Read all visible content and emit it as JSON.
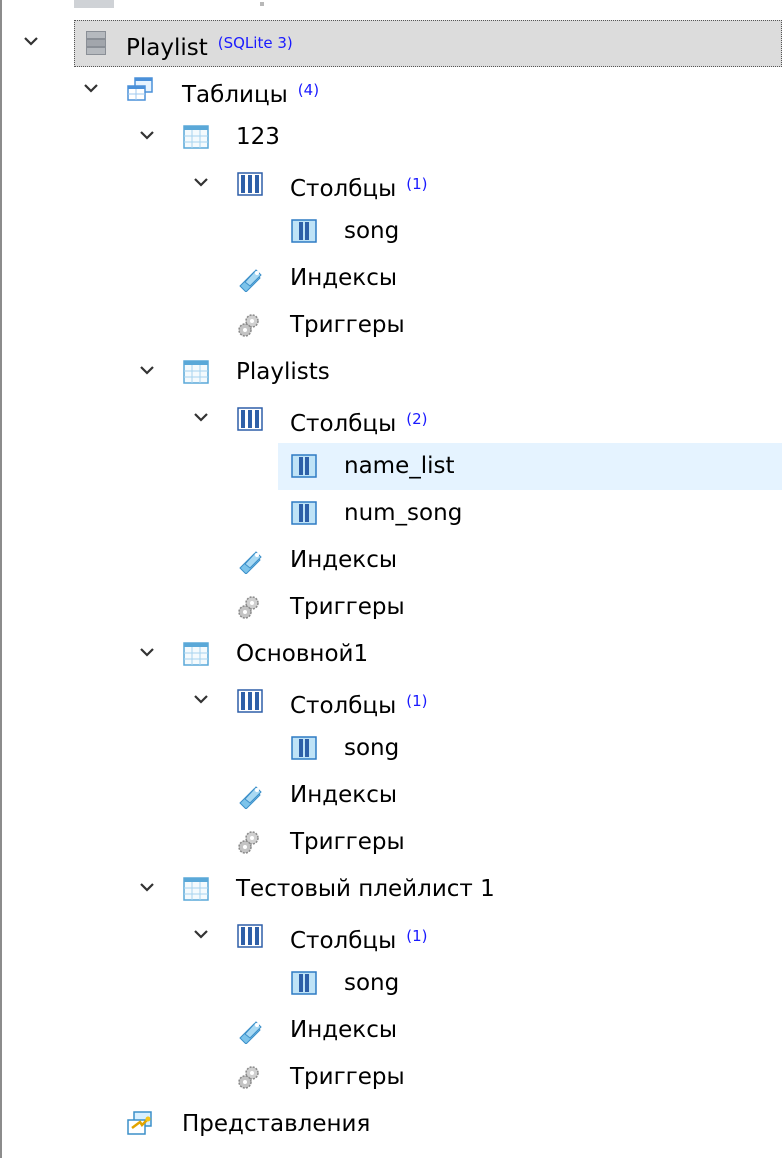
{
  "tree": {
    "root": {
      "label": "Playlist",
      "meta": "(SQLite 3)"
    },
    "tables_group": {
      "label": "Таблицы",
      "count": "(4)"
    },
    "tables": [
      {
        "name": "123",
        "columns_label": "Столбцы",
        "columns_count": "(1)",
        "columns": [
          "song"
        ],
        "indexes_label": "Индексы",
        "triggers_label": "Триггеры"
      },
      {
        "name": "Playlists",
        "columns_label": "Столбцы",
        "columns_count": "(2)",
        "columns": [
          "name_list",
          "num_song"
        ],
        "indexes_label": "Индексы",
        "triggers_label": "Триггеры"
      },
      {
        "name": "Основной1",
        "columns_label": "Столбцы",
        "columns_count": "(1)",
        "columns": [
          "song"
        ],
        "indexes_label": "Индексы",
        "triggers_label": "Триггеры"
      },
      {
        "name": "Тестовый плейлист 1",
        "columns_label": "Столбцы",
        "columns_count": "(1)",
        "columns": [
          "song"
        ],
        "indexes_label": "Индексы",
        "triggers_label": "Триггеры"
      }
    ],
    "views_group": {
      "label": "Представления"
    }
  },
  "colors": {
    "count_text": "#1a1aff",
    "selection_bg": "#dcdcdc",
    "hover_bg": "#e5f3ff"
  },
  "icons": {
    "database": "database-icon",
    "tables": "tables-group-icon",
    "table": "table-icon",
    "columns": "columns-icon",
    "column": "column-icon",
    "indexes": "indexes-icon",
    "triggers": "triggers-icon",
    "views": "views-icon",
    "expand": "chevron-down-icon"
  }
}
